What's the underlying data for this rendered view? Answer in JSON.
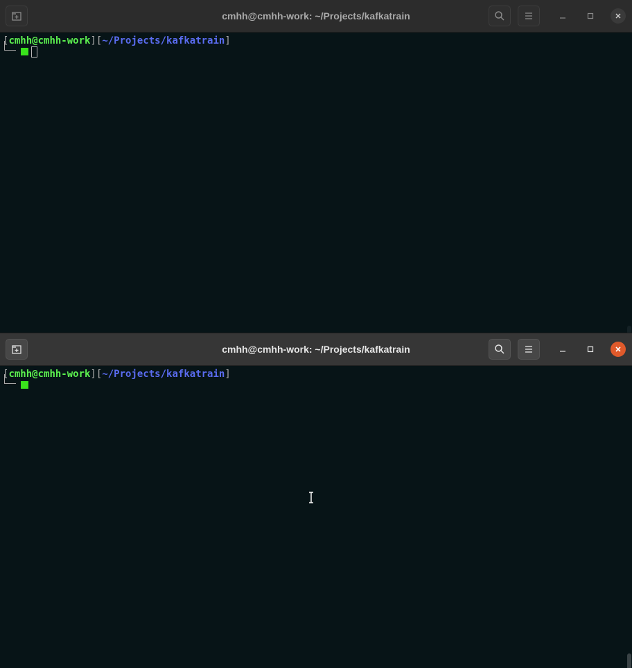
{
  "windows": [
    {
      "id": "top",
      "title": "cmhh@cmhh-work: ~/Projects/kafkatrain",
      "focused": false,
      "prompt": {
        "open1": "[",
        "user_host": "cmhh@cmhh-work",
        "close1": "]",
        "open2": "[",
        "path": "~/Projects/kafkatrain",
        "close2": "]"
      }
    },
    {
      "id": "bottom",
      "title": "cmhh@cmhh-work: ~/Projects/kafkatrain",
      "focused": true,
      "prompt": {
        "open1": "[",
        "user_host": "cmhh@cmhh-work",
        "close1": "]",
        "open2": "[",
        "path": "~/Projects/kafkatrain",
        "close2": "]"
      }
    }
  ],
  "icons": {
    "new_tab": "new-tab-icon",
    "search": "search-icon",
    "menu": "hamburger-menu-icon",
    "minimize": "minimize-icon",
    "maximize": "maximize-icon",
    "close": "close-icon",
    "pointer": "i-beam-cursor-icon"
  },
  "colors": {
    "terminal_bg": "#071417",
    "user_host": "#5cf04f",
    "path": "#5a6cf0",
    "bracket": "#a8a8a8",
    "cursor": "#39e21c",
    "close_active": "#e05a2b"
  }
}
